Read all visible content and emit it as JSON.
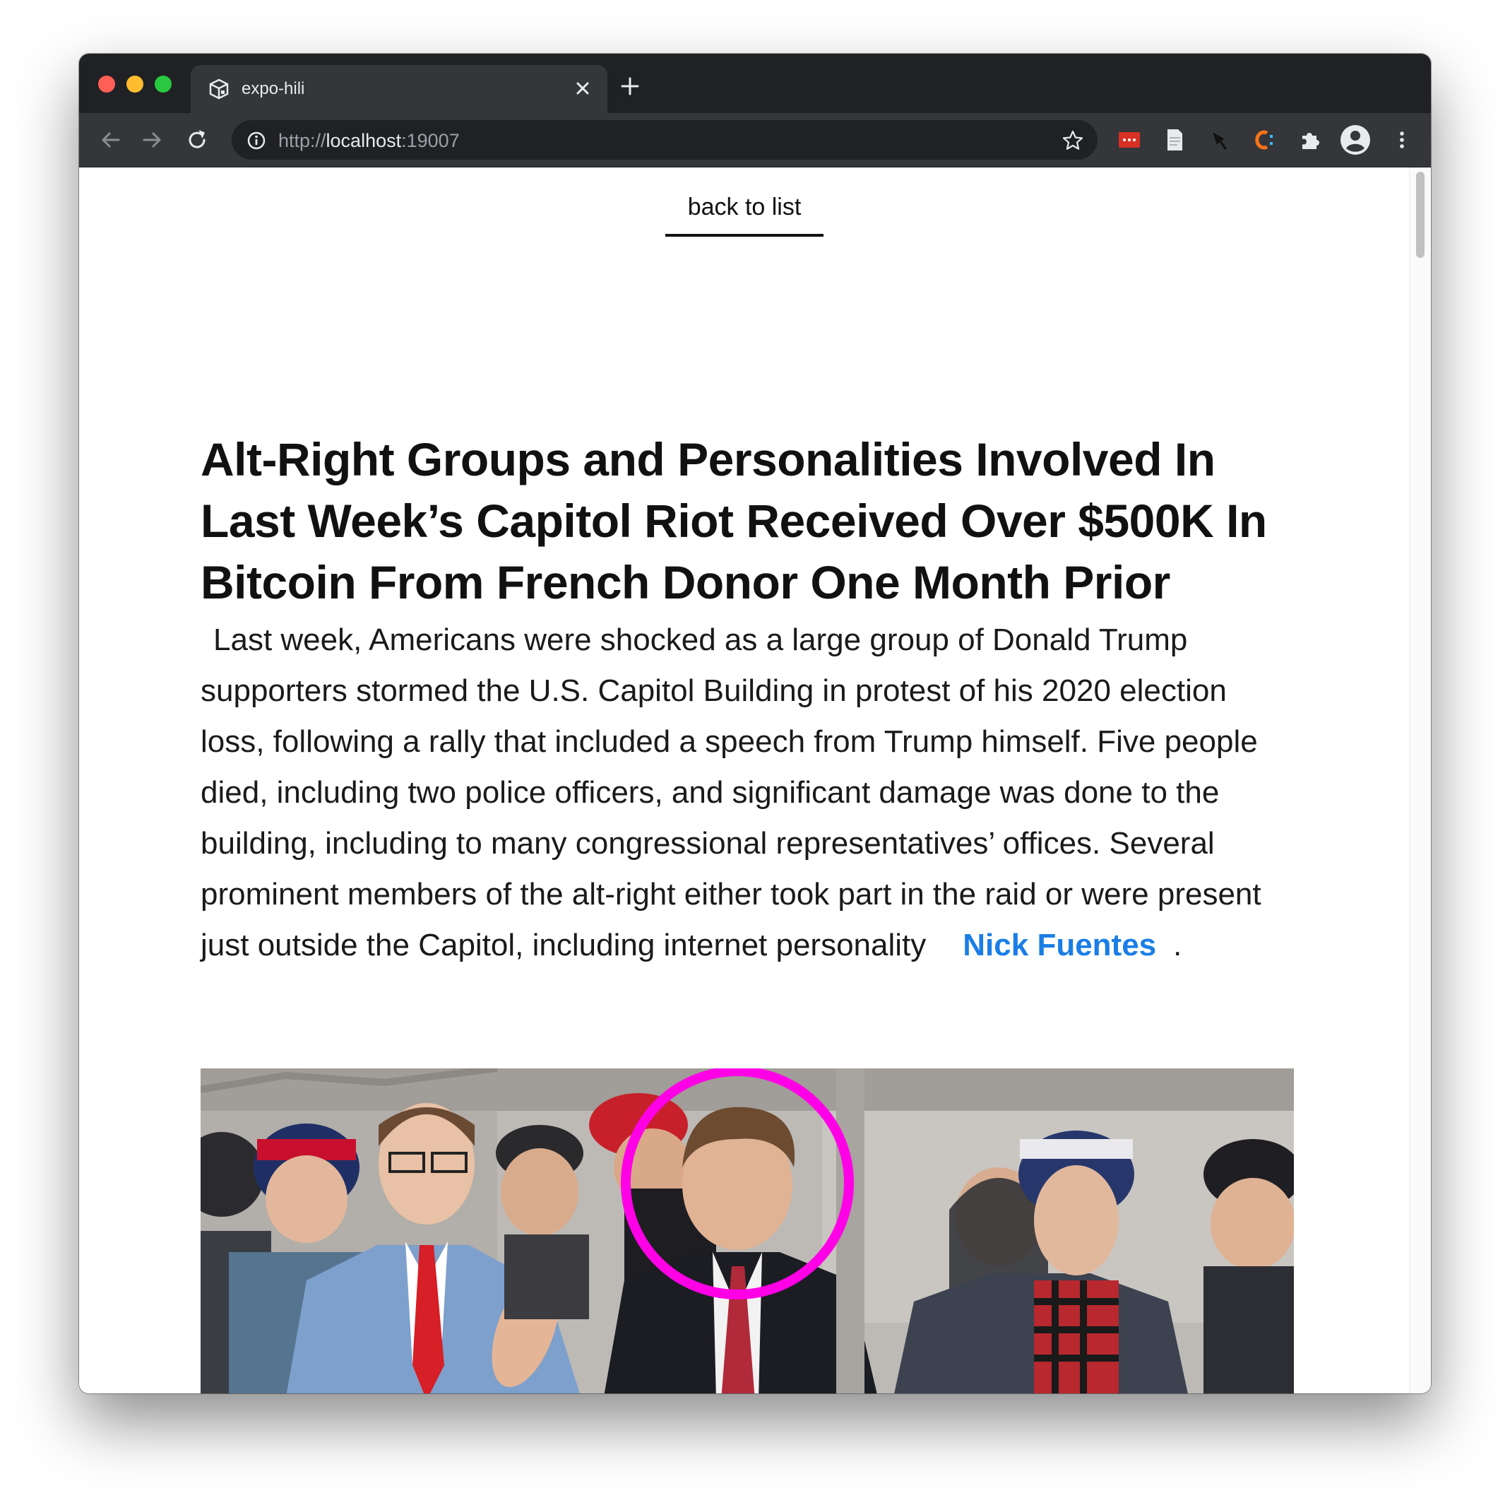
{
  "browser": {
    "tab_title": "expo-hili",
    "url_scheme": "http://",
    "url_host": "localhost",
    "url_port": ":19007"
  },
  "page": {
    "back_link": "back to list",
    "headline": "Alt-Right Groups and Personalities Involved In Last Week’s Capitol Riot Received Over $500K In Bitcoin From French Donor One Month Prior",
    "body_before_link": "Last week, Americans were shocked as a large group of Donald Trump supporters stormed the U.S. Capitol Building in protest of his 2020 election loss, following a rally that included a speech from Trump himself. Five people died, including two police officers, and significant damage was done to the building, including to many congressional representatives’ offices. Several prominent members of the alt-right either took part in the raid or were present just outside the Capitol, including internet personality",
    "body_link": "Nick Fuentes",
    "body_after_link": ".",
    "link_color": "#1a7ee6",
    "highlight_color": "#ff00e6"
  },
  "icons": {
    "tab_favicon": "cube-logo-icon",
    "tab_close": "close-icon",
    "new_tab": "plus-icon",
    "back": "arrow-left-icon",
    "forward": "arrow-right-icon",
    "reload": "reload-icon",
    "site_info": "info-icon",
    "bookmark": "star-icon",
    "extensions": [
      "password-manager-icon",
      "document-icon",
      "pin-icon",
      "c-extension-icon",
      "puzzle-icon"
    ],
    "profile": "avatar-icon",
    "menu": "more-vertical-icon"
  }
}
